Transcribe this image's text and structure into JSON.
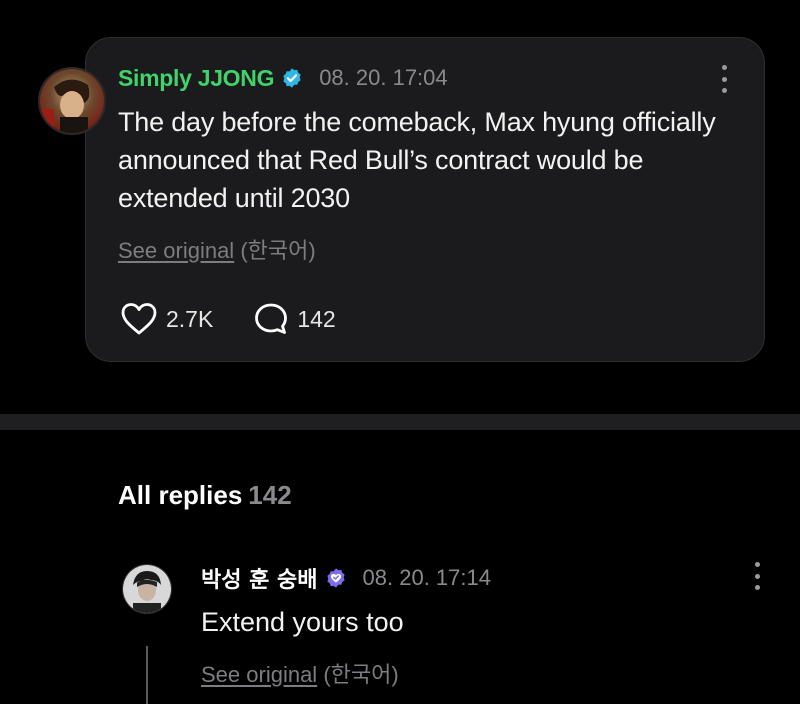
{
  "post": {
    "author": "Simply JJONG",
    "timestamp": "08. 20. 17:04",
    "body": "The day before the comeback, Max hyung officially announced that Red Bull’s contract would be extended until 2030",
    "see_original": "See original",
    "original_language": "(한국어)",
    "likes": "2.7K",
    "comments": "142",
    "badge_color": "#2fb6e8",
    "author_color": "#3fd36a"
  },
  "replies": {
    "heading": "All replies",
    "count": "142",
    "items": [
      {
        "author": "박성 훈 숭배",
        "timestamp": "08. 20. 17:14",
        "body": "Extend yours too",
        "see_original": "See original",
        "original_language": "(한국어)",
        "badge_color": "#7b6cf0"
      }
    ]
  },
  "icons": {
    "verified": "verified-check-icon",
    "like": "heart-icon",
    "comment": "speech-bubble-icon",
    "more": "more-vertical-icon"
  }
}
